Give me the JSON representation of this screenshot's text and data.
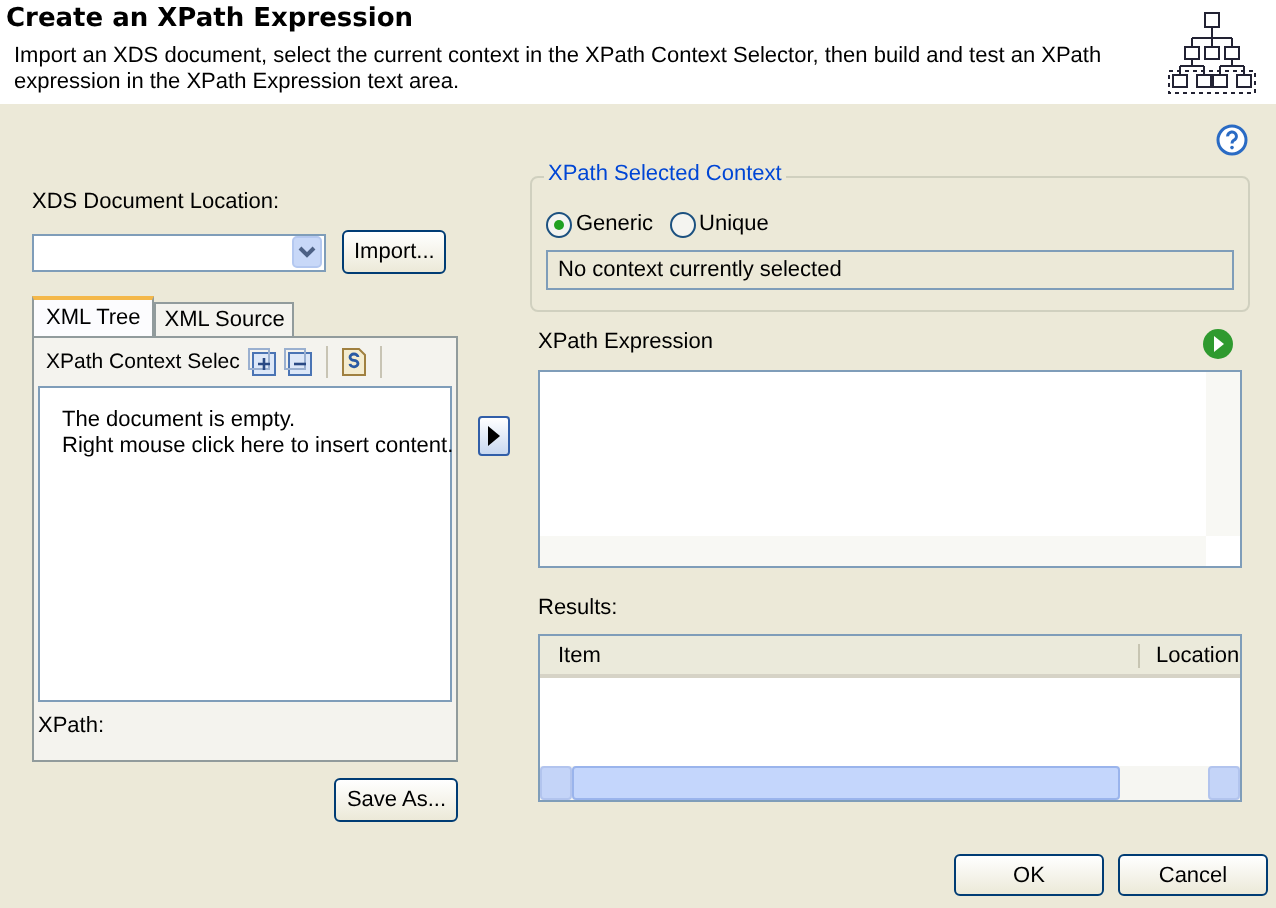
{
  "header": {
    "title": "Create an XPath Expression",
    "description": "Import an XDS document, select the current context in the XPath Context Selector, then build and test an XPath expression in the XPath Expression text area."
  },
  "document_location": {
    "label": "XDS Document Location:",
    "import_button": "Import..."
  },
  "tabs": [
    {
      "label": "XML Tree",
      "selected": true
    },
    {
      "label": "XML Source",
      "selected": false
    }
  ],
  "tree_toolbar": {
    "label": "XPath Context Selec"
  },
  "tree_message": [
    "The document is empty.",
    "Right mouse click here to insert content."
  ],
  "xpath_label": "XPath:",
  "save_as_button": "Save As...",
  "selected_context": {
    "title": "XPath Selected Context",
    "options": [
      {
        "label": "Generic",
        "selected": true
      },
      {
        "label": "Unique",
        "selected": false
      }
    ],
    "value": "No context currently selected"
  },
  "expression": {
    "label": "XPath Expression"
  },
  "results": {
    "label": "Results:",
    "columns": [
      "Item",
      "Location"
    ]
  },
  "buttons": [
    "OK",
    "Cancel"
  ]
}
